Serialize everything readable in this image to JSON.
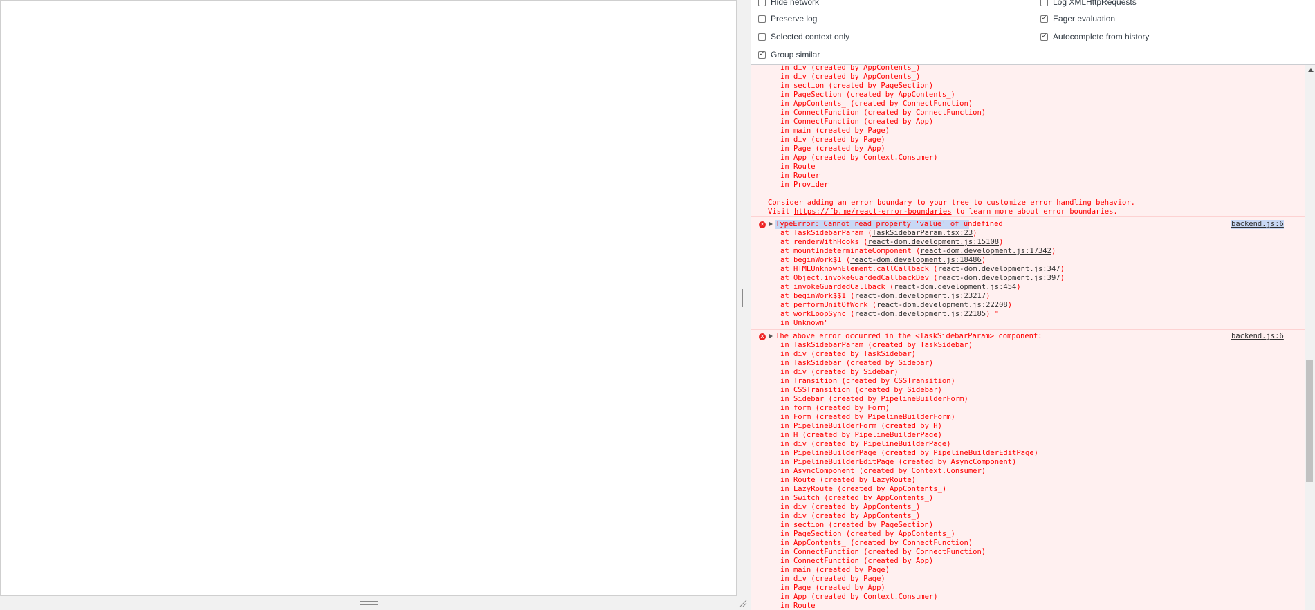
{
  "settings": {
    "left": [
      {
        "label": "Hide network",
        "checked": false
      },
      {
        "label": "Preserve log",
        "checked": false
      },
      {
        "label": "Selected context only",
        "checked": false
      },
      {
        "label": "Group similar",
        "checked": true
      }
    ],
    "right": [
      {
        "label": "Log XMLHttpRequests",
        "checked": false
      },
      {
        "label": "Eager evaluation",
        "checked": true
      },
      {
        "label": "Autocomplete from history",
        "checked": true
      }
    ]
  },
  "console": {
    "prev_tail": [
      "in div (created by AppContents_)",
      "in div (created by AppContents_)",
      "in section (created by PageSection)",
      "in PageSection (created by AppContents_)",
      "in AppContents_ (created by ConnectFunction)",
      "in ConnectFunction (created by ConnectFunction)",
      "in ConnectFunction (created by App)",
      "in main (created by Page)",
      "in div (created by Page)",
      "in Page (created by App)",
      "in App (created by Context.Consumer)",
      "in Route",
      "in Router",
      "in Provider"
    ],
    "boundary_hint": {
      "line1": "Consider adding an error boundary to your tree to customize error handling behavior.",
      "line2_pre": "Visit ",
      "line2_link": "https://fb.me/react-error-boundaries",
      "line2_post": " to learn more about error boundaries."
    },
    "error1": {
      "message": "TypeError: Cannot read property 'value' of undefined",
      "source": "backend.js:6",
      "frames": [
        {
          "pre": "at TaskSidebarParam (",
          "link": "TaskSidebarParam.tsx:23",
          "post": ")"
        },
        {
          "pre": "at renderWithHooks (",
          "link": "react-dom.development.js:15108",
          "post": ")"
        },
        {
          "pre": "at mountIndeterminateComponent (",
          "link": "react-dom.development.js:17342",
          "post": ")"
        },
        {
          "pre": "at beginWork$1 (",
          "link": "react-dom.development.js:18486",
          "post": ")"
        },
        {
          "pre": "at HTMLUnknownElement.callCallback (",
          "link": "react-dom.development.js:347",
          "post": ")"
        },
        {
          "pre": "at Object.invokeGuardedCallbackDev (",
          "link": "react-dom.development.js:397",
          "post": ")"
        },
        {
          "pre": "at invokeGuardedCallback (",
          "link": "react-dom.development.js:454",
          "post": ")"
        },
        {
          "pre": "at beginWork$$1 (",
          "link": "react-dom.development.js:23217",
          "post": ")"
        },
        {
          "pre": "at performUnitOfWork (",
          "link": "react-dom.development.js:22208",
          "post": ")"
        },
        {
          "pre": "at workLoopSync (",
          "link": "react-dom.development.js:22185",
          "post": ") \""
        },
        {
          "pre": "in Unknown\"",
          "link": "",
          "post": ""
        }
      ]
    },
    "error2": {
      "message": "The above error occurred in the <TaskSidebarParam> component:",
      "source": "backend.js:6",
      "frames": [
        "in TaskSidebarParam (created by TaskSidebar)",
        "in div (created by TaskSidebar)",
        "in TaskSidebar (created by Sidebar)",
        "in div (created by Sidebar)",
        "in Transition (created by CSSTransition)",
        "in CSSTransition (created by Sidebar)",
        "in Sidebar (created by PipelineBuilderForm)",
        "in form (created by Form)",
        "in Form (created by PipelineBuilderForm)",
        "in PipelineBuilderForm (created by H)",
        "in H (created by PipelineBuilderPage)",
        "in div (created by PipelineBuilderPage)",
        "in PipelineBuilderPage (created by PipelineBuilderEditPage)",
        "in PipelineBuilderEditPage (created by AsyncComponent)",
        "in AsyncComponent (created by Context.Consumer)",
        "in Route (created by LazyRoute)",
        "in LazyRoute (created by AppContents_)",
        "in Switch (created by AppContents_)",
        "in div (created by AppContents_)",
        "in div (created by AppContents_)",
        "in section (created by PageSection)",
        "in PageSection (created by AppContents_)",
        "in AppContents_ (created by ConnectFunction)",
        "in ConnectFunction (created by ConnectFunction)",
        "in ConnectFunction (created by App)",
        "in main (created by Page)",
        "in div (created by Page)",
        "in Page (created by App)",
        "in App (created by Context.Consumer)",
        "in Route"
      ]
    }
  }
}
